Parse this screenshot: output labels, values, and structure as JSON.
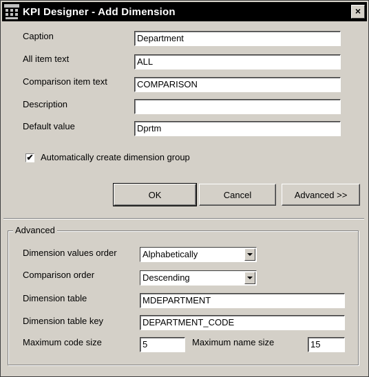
{
  "window": {
    "title": "KPI Designer - Add Dimension",
    "close_label": "×"
  },
  "fields": {
    "caption": {
      "label": "Caption",
      "value": "Department"
    },
    "all_item": {
      "label": "All item text",
      "value": "ALL"
    },
    "comparison_item": {
      "label": "Comparison item text",
      "value": "COMPARISON"
    },
    "description": {
      "label": "Description",
      "value": ""
    },
    "default_value": {
      "label": "Default value",
      "value": "Dprtm"
    }
  },
  "checkbox": {
    "label": "Automatically create dimension group",
    "checked": true,
    "mark": "✔"
  },
  "buttons": {
    "ok": "OK",
    "cancel": "Cancel",
    "advanced": "Advanced >>"
  },
  "advanced": {
    "title": "Advanced",
    "values_order": {
      "label": "Dimension values order",
      "value": "Alphabetically"
    },
    "comparison_order": {
      "label": "Comparison order",
      "value": "Descending"
    },
    "table": {
      "label": "Dimension table",
      "value": "MDEPARTMENT"
    },
    "table_key": {
      "label": "Dimension table key",
      "value": "DEPARTMENT_CODE"
    },
    "max_code": {
      "label": "Maximum code size",
      "value": "5"
    },
    "max_name": {
      "label": "Maximum name size",
      "value": "15"
    }
  }
}
